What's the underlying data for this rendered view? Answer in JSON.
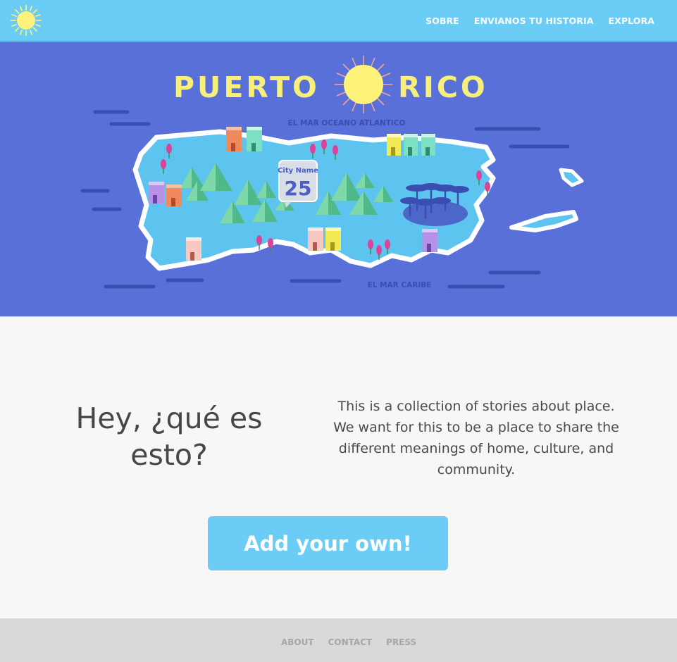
{
  "nav": {
    "items": [
      {
        "label": "SOBRE"
      },
      {
        "label": "ENVIANOS TU HISTORIA"
      },
      {
        "label": "EXPLORA"
      }
    ]
  },
  "hero": {
    "title_left": "PUERTO",
    "title_right": "RICO",
    "ocean_north": "EL MAR OCEANO ATLANTICO",
    "sea_south": "EL MAR CARIBE",
    "marker": {
      "city": "City Name",
      "count": "25"
    }
  },
  "intro": {
    "heading_line1": "Hey, ¿qué es",
    "heading_line2": "esto?",
    "blurb_lines": [
      "This is a collection of stories about place.",
      "We want for this to be a place to share the",
      "different meanings of home, culture, and",
      "community."
    ],
    "cta_label": "Add your own!"
  },
  "footer": {
    "links": [
      {
        "label": "ABOUT"
      },
      {
        "label": "CONTACT"
      },
      {
        "label": "PRESS"
      }
    ]
  },
  "colors": {
    "topbar": "#6bcdf6",
    "hero_bg": "#5a70d9",
    "island": "#5dc4f0",
    "sun": "#fff27a",
    "title": "#f6f07a",
    "footer": "#d9d9d9"
  },
  "icons": {
    "logo": "sun-icon",
    "marker": "location-marker-icon"
  }
}
